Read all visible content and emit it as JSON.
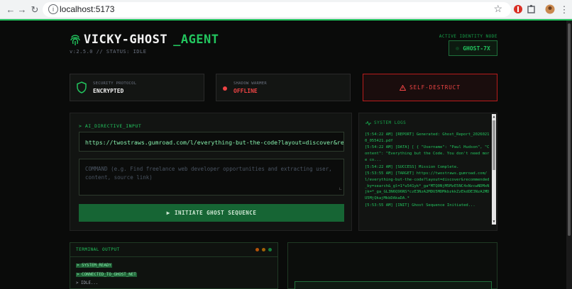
{
  "browser": {
    "url": "localhost:5173",
    "back_icon": "arrow-left-icon",
    "forward_icon": "arrow-right-icon",
    "reload_icon": "reload-icon"
  },
  "header": {
    "title_main": "VICKY-GHOST",
    "title_accent": "_AGENT",
    "version_status": "v:2.5.0 // STATUS: IDLE",
    "identity_label": "ACTIVE IDENTITY NODE",
    "identity_value": "GHOST-7X"
  },
  "cards": {
    "security": {
      "label": "SECURITY PROTOCOL",
      "value": "ENCRYPTED",
      "icon": "shield-icon"
    },
    "shadow": {
      "label": "SHADOW WARMER",
      "value": "OFFLINE",
      "icon": "status-dot-icon"
    },
    "destruct_label": "SELF-DESTRUCT"
  },
  "directive": {
    "heading": "> AI_DIRECTIVE_INPUT",
    "url_value": "https://twostraws.gumroad.com/l/everything-but-the-code?layout=discover&recommended_by=search",
    "command_placeholder": "COMMAND (e.g. Find freelance web developer opportunities and extracting user, content, source link)",
    "button_label": "INITIATE GHOST SEQUENCE"
  },
  "logs": {
    "heading": "SYSTEM LOGS",
    "entries": [
      "[5:54:22 AM] [REPORT] Generated: Ghost_Report_20260210_055421.pdf",
      "[5:54:22 AM] [DATA] [ { \"Username\": \"Paul Hudson\", \"Content\": \"Everything but the Code. You don't need more co...",
      "[5:54:22 AM] [SUCCESS] Mission Complete.",
      "[5:53:55 AM] [TARGET] https://twostraws.gumroad.com/l/everything-but-the-code?layout=discover&recommended_by=search&_gl=1*u541yk*_ga*MTQ0NjM5MzE5NC4xNzcwNDMxNjk=*_ga_GL3N6Q96NS*czE3NzA2MDU5MDMkbzkkZzEkdDE3NzA2MDU5MjQkajMkbDAkaDA.*",
      "[5:53:55 AM] [INIT] Ghost Sequence Initiated..."
    ]
  },
  "terminal": {
    "title": "TERMINAL OUTPUT",
    "lines": [
      "> SYSTEM_READY",
      "> CONNECTED_TO_GHOST_NET",
      "> IDLE..."
    ]
  },
  "colors": {
    "accent": "#22c55e",
    "danger": "#ef4444",
    "background": "#0a0b0a"
  }
}
